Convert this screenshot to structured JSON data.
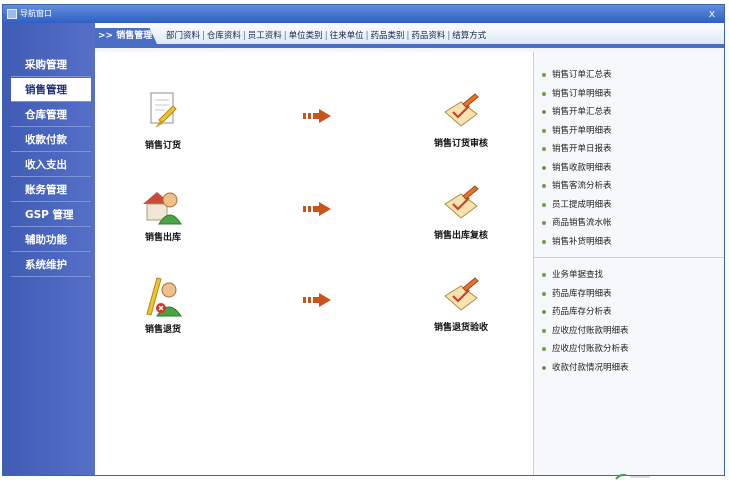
{
  "window": {
    "title": "导航窗口",
    "close_label": "x"
  },
  "sidebar": {
    "items": [
      {
        "label": "采购管理"
      },
      {
        "label": "销售管理",
        "active": true
      },
      {
        "label": "仓库管理"
      },
      {
        "label": "收款付款"
      },
      {
        "label": "收入支出"
      },
      {
        "label": "账务管理"
      },
      {
        "label": "GSP 管理"
      },
      {
        "label": "辅助功能"
      },
      {
        "label": "系统维护"
      }
    ]
  },
  "topbar": {
    "active_tab": ">> 销售管理",
    "links": [
      "部门资料",
      "仓库资料",
      "员工资料",
      "单位类别",
      "往来单位",
      "药品类别",
      "药品资料",
      "结算方式"
    ]
  },
  "flow": {
    "rows": [
      {
        "left": "销售订货",
        "right": "销售订货审核"
      },
      {
        "left": "销售出库",
        "right": "销售出库复核"
      },
      {
        "left": "销售退货",
        "right": "销售退货验收"
      }
    ]
  },
  "reports": {
    "group1": [
      "销售订单汇总表",
      "销售订单明细表",
      "销售开单汇总表",
      "销售开单明细表",
      "销售开单日报表",
      "销售收款明细表",
      "销售客流分析表",
      "员工提成明细表",
      "商品销售流水帐",
      "销售补货明细表"
    ],
    "group2": [
      "业务单据查找",
      "药品库存明细表",
      "药品库存分析表",
      "应收应付账款明细表",
      "应收应付账款分析表",
      "收款付款情况明细表"
    ]
  },
  "colors": {
    "sidebar": "#4a62bb",
    "accent": "#4a6dc6",
    "arrow": "#c8531b",
    "bullet": "#6fa04a"
  }
}
